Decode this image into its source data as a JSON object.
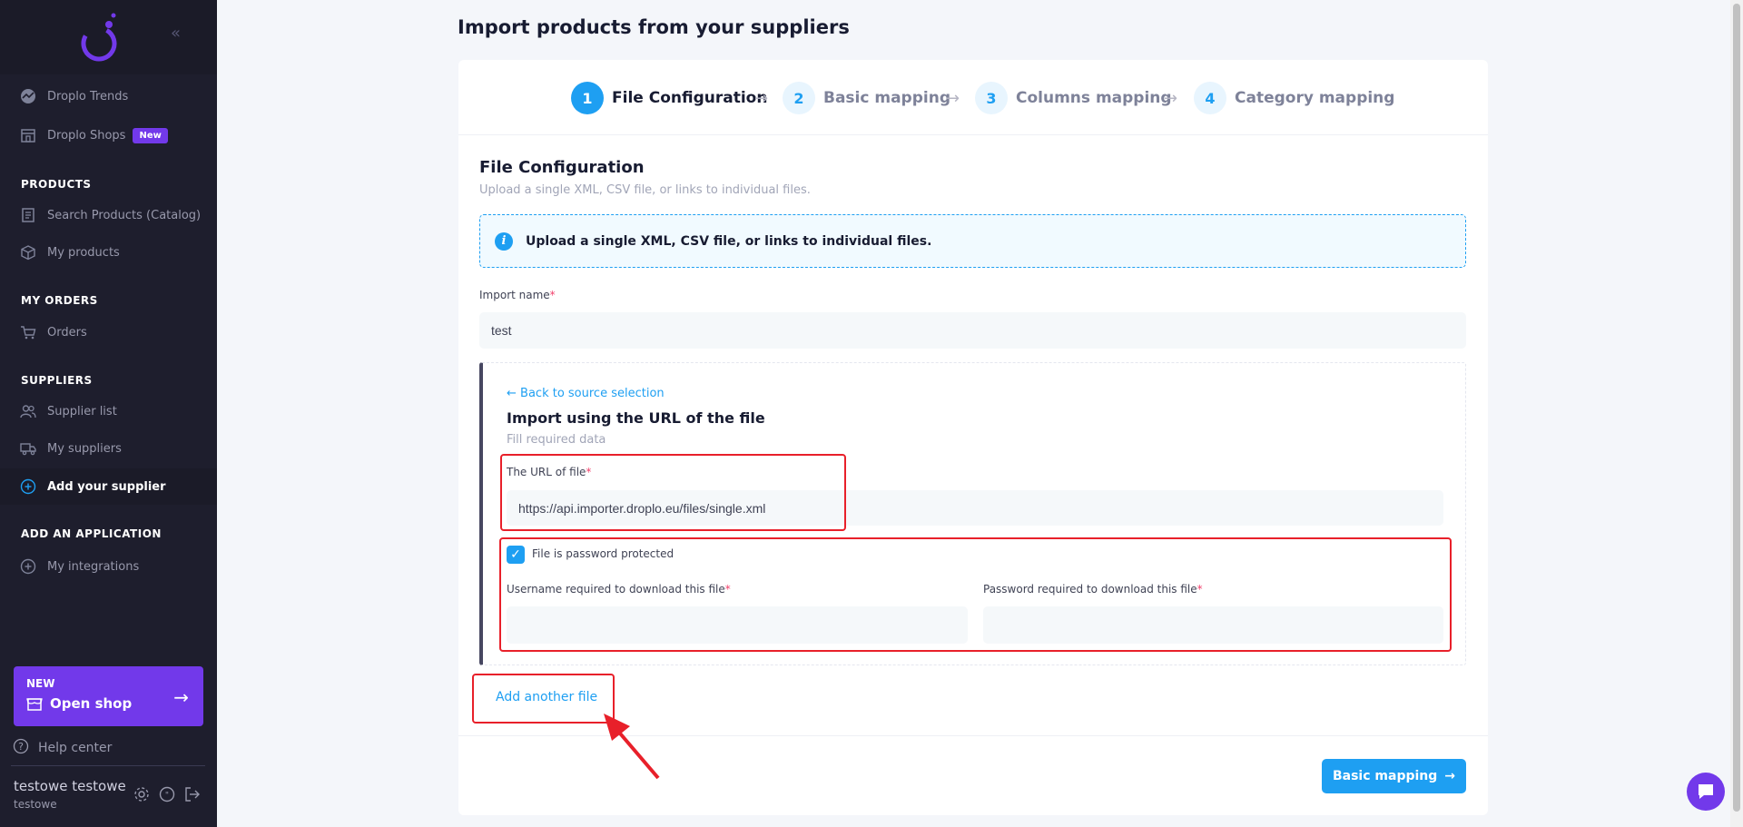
{
  "sidebar": {
    "items": [
      {
        "label": "Droplo Trends",
        "icon": "trend-icon"
      },
      {
        "label": "Droplo Shops",
        "icon": "shop-icon",
        "badge": "New"
      },
      {
        "label": "Search Products (Catalog)",
        "icon": "catalog-icon"
      },
      {
        "label": "My products",
        "icon": "box-icon"
      },
      {
        "label": "Orders",
        "icon": "cart-icon"
      },
      {
        "label": "Supplier list",
        "icon": "users-icon"
      },
      {
        "label": "My suppliers",
        "icon": "truck-icon"
      },
      {
        "label": "Add your supplier",
        "icon": "plus-circle-icon",
        "active": true
      },
      {
        "label": "My integrations",
        "icon": "plus-circle-icon"
      }
    ],
    "sections": {
      "products": "PRODUCTS",
      "my_orders": "MY ORDERS",
      "suppliers": "SUPPLIERS",
      "add_application": "ADD AN APPLICATION"
    },
    "shop_card": {
      "tag": "NEW",
      "label": "Open shop"
    },
    "help": "Help center",
    "user": {
      "name": "testowe testowe",
      "sub": "testowe"
    }
  },
  "page": {
    "title": "Import products from your suppliers"
  },
  "steps": [
    {
      "num": "1",
      "label": "File Configuration",
      "active": true
    },
    {
      "num": "2",
      "label": "Basic mapping"
    },
    {
      "num": "3",
      "label": "Columns mapping"
    },
    {
      "num": "4",
      "label": "Category mapping"
    }
  ],
  "config": {
    "title": "File Configuration",
    "subtitle": "Upload a single XML, CSV file, or links to individual files.",
    "info": "Upload a single XML, CSV file, or links to individual files.",
    "import_name_label": "Import name",
    "import_name_value": "test"
  },
  "url_panel": {
    "back": "Back to source selection",
    "title": "Import using the URL of the file",
    "subtitle": "Fill required data",
    "url_label": "The URL of file",
    "url_value": "https://api.importer.droplo.eu/files/single.xml",
    "password_protected_label": "File is password protected",
    "password_protected": true,
    "username_label": "Username required to download this file",
    "username_value": "",
    "password_label": "Password required to download this file",
    "password_value": ""
  },
  "actions": {
    "add_file": "Add another file",
    "next": "Basic mapping"
  },
  "colors": {
    "accent": "#1e9ff2",
    "purple": "#7239ea",
    "sidebar": "#1e1e2d",
    "annotation": "#e8202a"
  }
}
